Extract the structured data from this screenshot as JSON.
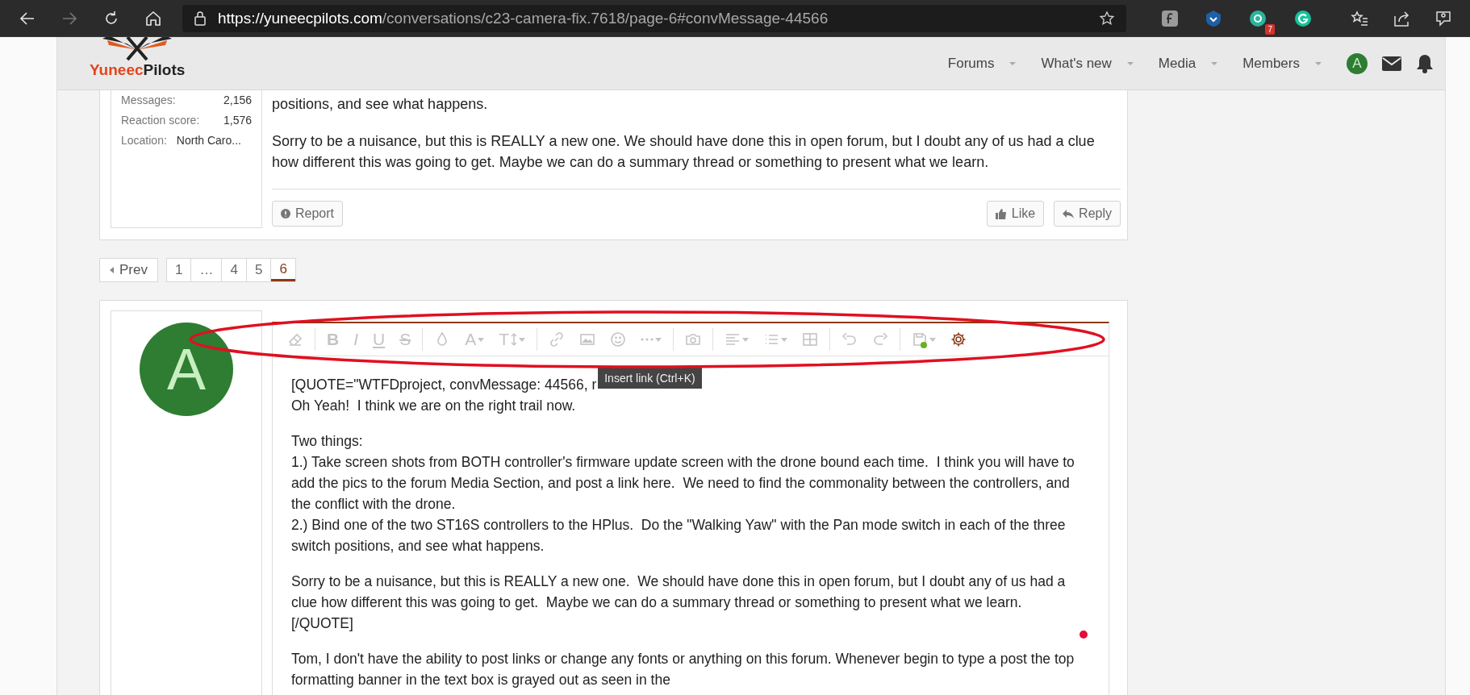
{
  "browser": {
    "nav_buttons": [
      {
        "kind": "back",
        "disabled": false
      },
      {
        "kind": "forward",
        "disabled": true
      },
      {
        "kind": "refresh",
        "disabled": false
      },
      {
        "kind": "home",
        "disabled": false
      }
    ],
    "address": {
      "origin": "https://yuneecpilots.com",
      "path": "/conversations/c23-camera-fix.7618/page-6#convMessage-44566"
    },
    "extensions": [
      {
        "kind": "f-square"
      },
      {
        "kind": "shield"
      },
      {
        "kind": "green-circle",
        "badge": "7"
      },
      {
        "kind": "g-circle"
      }
    ]
  },
  "header": {
    "logo": {
      "part1": "Yuneec",
      "part2": "Pilots"
    },
    "nav": [
      {
        "label": "Forums"
      },
      {
        "label": "What's new"
      },
      {
        "label": "Media"
      },
      {
        "label": "Members"
      }
    ],
    "avatar": "A"
  },
  "previous_message": {
    "stats": [
      {
        "label": "Messages:",
        "value": "2,156"
      },
      {
        "label": "Reaction score:",
        "value": "1,576"
      },
      {
        "label": "Location:",
        "value": "North Caro..."
      }
    ],
    "paragraphs": [
      "positions, and see what happens.",
      "Sorry to be a nuisance, but this is REALLY a new one. We should have done this in open forum, but I doubt any of us had a clue how different this was going to get. Maybe we can do a summary thread or something to present what we learn."
    ],
    "report": "Report",
    "like": "Like",
    "reply": "Reply"
  },
  "pagination": {
    "prev": "Prev",
    "pages": [
      {
        "label": "1",
        "selected": false
      },
      {
        "label": "…",
        "selected": false
      },
      {
        "label": "4",
        "selected": false
      },
      {
        "label": "5",
        "selected": false
      },
      {
        "label": "6",
        "selected": true
      }
    ]
  },
  "editor": {
    "avatar": "A",
    "toolbar": [
      [
        {
          "kind": "eraser",
          "disabled": true
        }
      ],
      [
        {
          "kind": "bold",
          "glyph": "B",
          "disabled": true
        },
        {
          "kind": "italic",
          "glyph": "I",
          "disabled": true
        },
        {
          "kind": "underline",
          "glyph": "U",
          "disabled": true
        },
        {
          "kind": "strike",
          "glyph": "S",
          "disabled": true
        }
      ],
      [
        {
          "kind": "droplet",
          "disabled": true
        },
        {
          "kind": "font-color",
          "glyph": "A",
          "dropdown": true,
          "disabled": true
        },
        {
          "kind": "font-size",
          "glyph": "T",
          "dropdown": true,
          "disabled": true
        }
      ],
      [
        {
          "kind": "link",
          "disabled": true
        },
        {
          "kind": "image",
          "disabled": true
        },
        {
          "kind": "smiley",
          "disabled": true
        },
        {
          "kind": "more",
          "dropdown": true,
          "disabled": true
        }
      ],
      [
        {
          "kind": "camera",
          "disabled": true
        }
      ],
      [
        {
          "kind": "align",
          "dropdown": true,
          "disabled": true
        },
        {
          "kind": "list",
          "dropdown": true,
          "disabled": true
        },
        {
          "kind": "table",
          "disabled": true
        }
      ],
      [
        {
          "kind": "undo",
          "disabled": true
        },
        {
          "kind": "redo",
          "disabled": true
        }
      ],
      [
        {
          "kind": "save",
          "dropdown": true,
          "disabled": true
        },
        {
          "kind": "gear",
          "disabled": false
        }
      ]
    ],
    "tooltip": "Insert link (Ctrl+K)",
    "paragraphs": [
      [
        "[QUOTE=\"WTFDproject, convMessage: 44566, r",
        "Oh Yeah!  I think we are on the right trail now."
      ],
      [
        "Two things:",
        "1.) Take screen shots from BOTH controller's firmware update screen with the drone bound each time.  I think you will have to add the pics to the forum Media Section, and post a link here.  We need to find the commonality between the controllers, and the conflict with the drone.",
        "2.) Bind one of the two ST16S controllers to the HPlus.  Do the \"Walking Yaw\" with the Pan mode switch in each of the three switch positions, and see what happens."
      ],
      [
        "Sorry to be a nuisance, but this is REALLY a new one.  We should have done this in open forum, but I doubt any of us had a clue how different this was going to get.  Maybe we can do a summary thread or something to present what we learn.",
        "[/QUOTE]"
      ],
      [
        "Tom, I don't have the ability to post links or change any fonts or anything on this forum. Whenever begin to type a post the top formatting banner in the text box is grayed out as seen in the"
      ]
    ]
  }
}
